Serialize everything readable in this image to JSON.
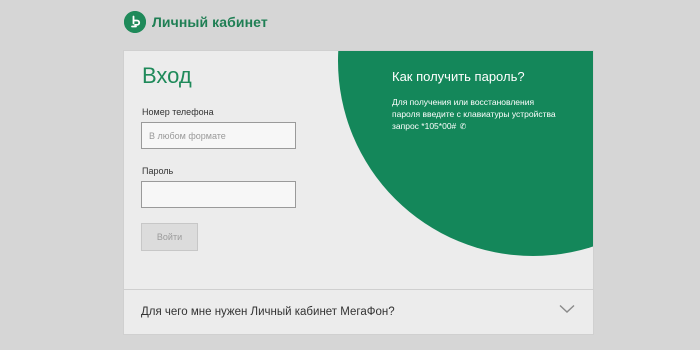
{
  "header": {
    "logo_text": "Личный кабинет"
  },
  "login": {
    "title": "Вход",
    "phone_label": "Номер телефона",
    "phone_placeholder": "В любом формате",
    "password_label": "Пароль",
    "submit_label": "Войти"
  },
  "promo": {
    "title": "Как получить пароль?",
    "text": "Для получения или восстановления пароля введите с клавиатуры устройства запрос *105*00#",
    "icon": "phone-icon"
  },
  "faq": {
    "label": "Для чего мне нужен Личный кабинет МегаФон?",
    "icon": "chevron-down-icon"
  },
  "colors": {
    "brand_green": "#14875a",
    "background": "#d6d6d6",
    "card": "#ececec"
  }
}
